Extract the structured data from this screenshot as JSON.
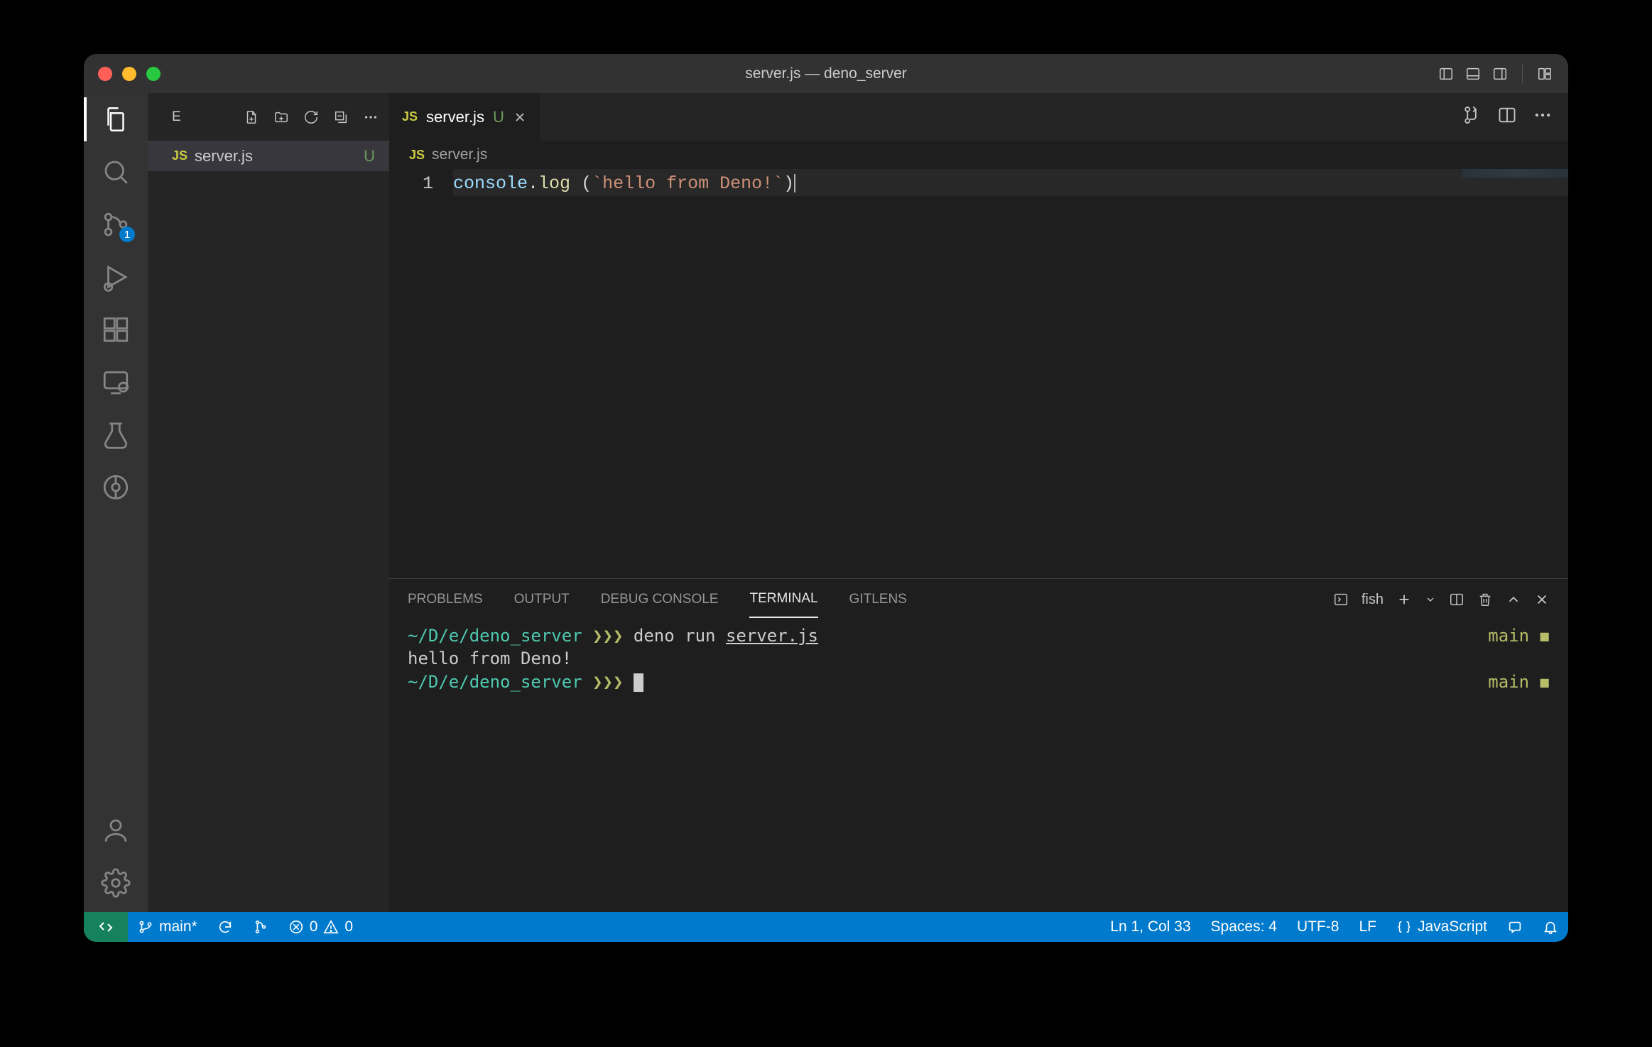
{
  "titlebar": {
    "title": "server.js — deno_server"
  },
  "activitybar": {
    "scm_badge": "1"
  },
  "sidebar": {
    "header_letter": "E",
    "file": {
      "name": "server.js",
      "status": "U"
    }
  },
  "tabs": {
    "open": {
      "name": "server.js",
      "status": "U"
    }
  },
  "breadcrumb": {
    "file": "server.js"
  },
  "editor": {
    "line_number": "1",
    "code": {
      "id": "console",
      "dot": ".",
      "fn": "log",
      "sp": " ",
      "lp": "(",
      "str": "`hello from Deno!`",
      "rp": ")"
    }
  },
  "panel": {
    "tabs": [
      "PROBLEMS",
      "OUTPUT",
      "DEBUG CONSOLE",
      "TERMINAL",
      "GITLENS"
    ],
    "active_index": 3,
    "shell_label": "fish"
  },
  "terminal": {
    "line1": {
      "cwd": "~/D/e/deno_server",
      "arrows": "❯❯❯",
      "cmd": "deno run ",
      "arg": "server.js",
      "branch": "main",
      "dirty": "◼"
    },
    "line2": {
      "text": "hello from Deno!"
    },
    "line3": {
      "cwd": "~/D/e/deno_server",
      "arrows": "❯❯❯",
      "branch": "main",
      "dirty": "◼"
    }
  },
  "statusbar": {
    "branch": "main*",
    "errors": "0",
    "warnings": "0",
    "position": "Ln 1, Col 33",
    "spaces": "Spaces: 4",
    "encoding": "UTF-8",
    "eol": "LF",
    "language": "JavaScript"
  }
}
